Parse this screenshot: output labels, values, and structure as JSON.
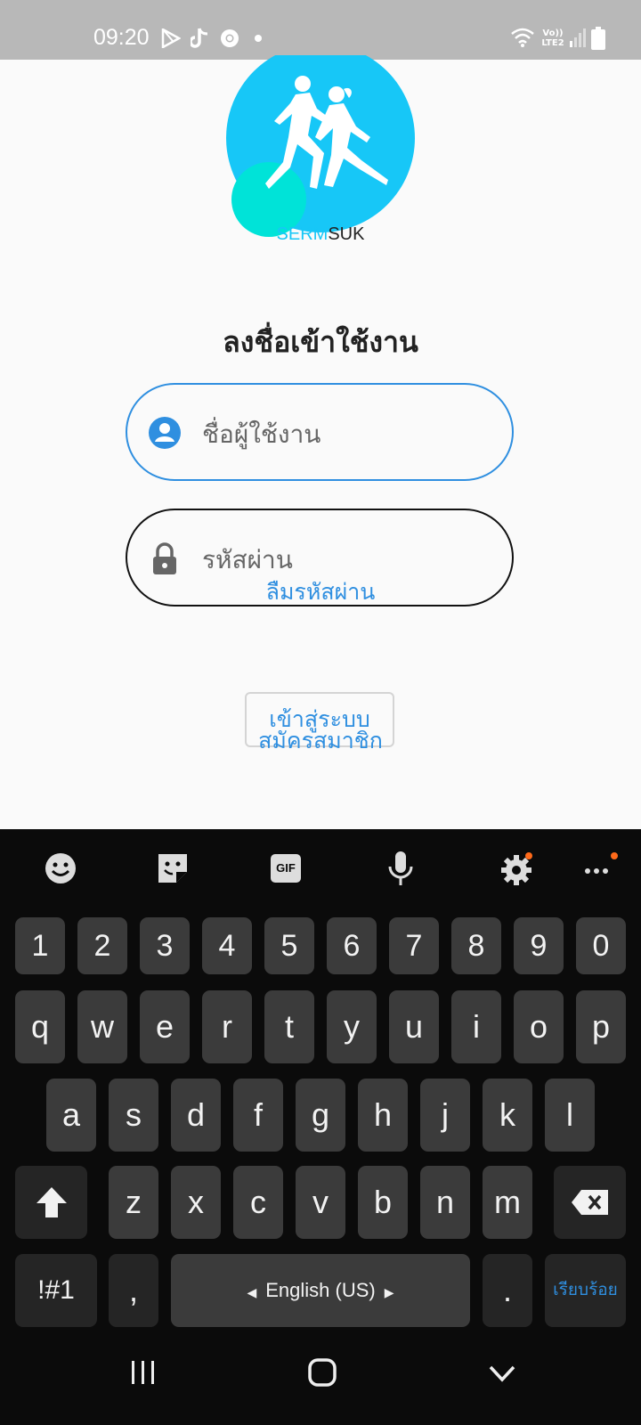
{
  "status_bar": {
    "time": "09:20",
    "network_label": "Vo))\nLTE2",
    "icons": [
      "play-store-icon",
      "tiktok-icon",
      "chrome-icon",
      "dot-icon",
      "wifi-icon",
      "signal-icon",
      "battery-icon"
    ]
  },
  "logo": {
    "brand_part1": "SERM",
    "brand_part2": "SUK"
  },
  "login": {
    "title": "ลงชื่อเข้าใช้งาน",
    "username_placeholder": "ชื่อผู้ใช้งาน",
    "password_placeholder": "รหัสผ่าน",
    "forgot_password": "ลืมรหัสผ่าน",
    "login_button": "เข้าสู่ระบบ",
    "register": "สมัครสมาชิก"
  },
  "keyboard": {
    "toolbar": [
      "emoji-icon",
      "sticker-icon",
      "gif-icon",
      "microphone-icon",
      "settings-icon",
      "more-icon"
    ],
    "gif_label": "GIF",
    "number_row": [
      "1",
      "2",
      "3",
      "4",
      "5",
      "6",
      "7",
      "8",
      "9",
      "0"
    ],
    "row1": [
      "q",
      "w",
      "e",
      "r",
      "t",
      "y",
      "u",
      "i",
      "o",
      "p"
    ],
    "row2": [
      "a",
      "s",
      "d",
      "f",
      "g",
      "h",
      "j",
      "k",
      "l"
    ],
    "row3": [
      "z",
      "x",
      "c",
      "v",
      "b",
      "n",
      "m"
    ],
    "symbols_key": "!#1",
    "comma_key": ",",
    "space_label": "English (US)",
    "period_key": ".",
    "done_key": "เรียบร้อย"
  },
  "colors": {
    "accent": "#2f8fe0",
    "logo_blue": "#17c7f7",
    "logo_teal": "#00e3d8",
    "keyboard_bg": "#0b0b0b",
    "key_bg": "#3b3b3b",
    "notification": "#ff6a1a"
  }
}
